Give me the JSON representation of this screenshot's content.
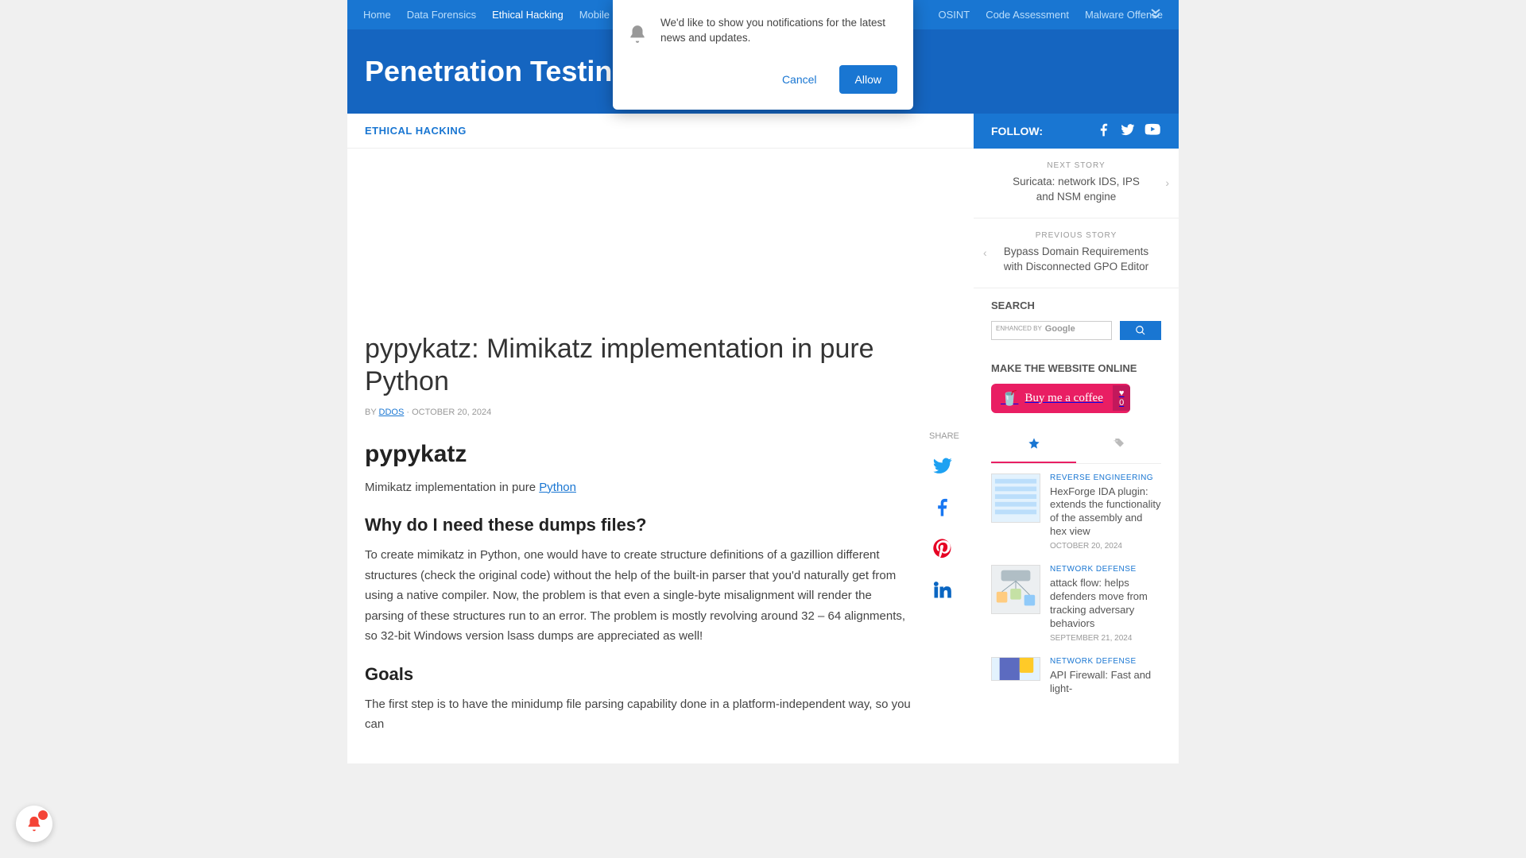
{
  "nav": [
    "Home",
    "Data Forensics",
    "Ethical Hacking",
    "Mobile Hac",
    "OSINT",
    "Code Assessment",
    "Malware Offense"
  ],
  "hero": {
    "title": "Penetration Testing T"
  },
  "notification": {
    "text": "We'd like to show you notifications for the latest news and updates.",
    "cancel": "Cancel",
    "allow": "Allow"
  },
  "crumb": {
    "label": "ETHICAL HACKING"
  },
  "article": {
    "title": "pypykatz: Mimikatz implementation in pure Python",
    "by": "BY",
    "author": "DDOS",
    "date": "OCTOBER 20, 2024",
    "sep": " · ",
    "h2": "pypykatz",
    "intro_pre": "Mimikatz implementation in pure ",
    "intro_link": "Python",
    "h3a": "Why do I need these dumps files?",
    "p2": "To create mimikatz in Python, one would have to create structure definitions of a gazillion different structures (check the original code) without the help of the built-in parser that you'd naturally get from using a native compiler. Now, the problem is that even a single-byte misalignment will render the parsing of these structures run to an error. The problem is mostly revolving around 32 – 64 alignments, so 32-bit Windows version lsass dumps are appreciated as well!",
    "h3b": "Goals",
    "p3": "The first step is to have the minidump file parsing capability done in a platform-independent way, so you can"
  },
  "share": {
    "label": "SHARE"
  },
  "follow": {
    "label": "FOLLOW:"
  },
  "sidebar": {
    "next": {
      "tag": "NEXT STORY",
      "title": "Suricata: network IDS, IPS and NSM engine"
    },
    "prev": {
      "tag": "PREVIOUS STORY",
      "title": "Bypass Domain Requirements with Disconnected GPO Editor"
    },
    "search": {
      "heading": "SEARCH",
      "badge_pre": "ENHANCED BY",
      "badge_brand": "Google"
    },
    "bmc": {
      "heading": "MAKE THE WEBSITE ONLINE",
      "label": "Buy me a coffee",
      "count": "0"
    },
    "posts": [
      {
        "cat": "REVERSE ENGINEERING",
        "title": "HexForge IDA plugin: extends the functionality of the assembly and hex view",
        "date": "OCTOBER 20, 2024"
      },
      {
        "cat": "NETWORK DEFENSE",
        "title": "attack flow: helps defenders move from tracking adversary behaviors",
        "date": "SEPTEMBER 21, 2024"
      },
      {
        "cat": "NETWORK DEFENSE",
        "title": "API Firewall: Fast and light-",
        "date": ""
      }
    ]
  }
}
